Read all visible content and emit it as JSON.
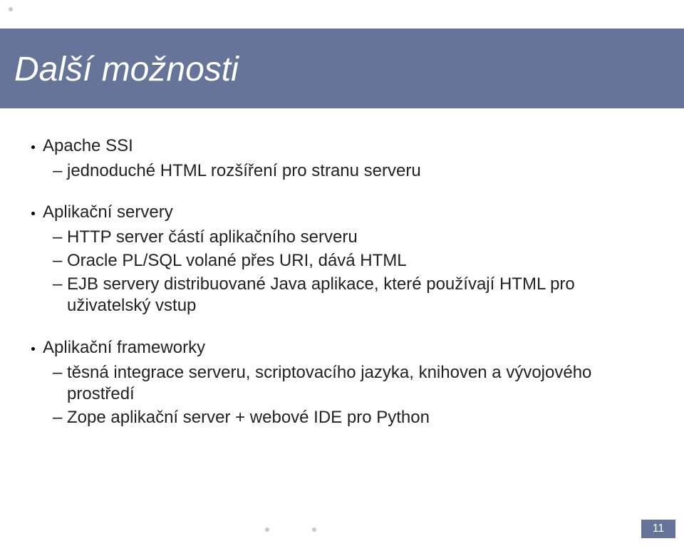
{
  "title": "Další možnosti",
  "sections": [
    {
      "heading": "Apache SSI",
      "items": [
        "jednoduché HTML rozšíření pro stranu serveru"
      ]
    },
    {
      "heading": "Aplikační servery",
      "items": [
        "HTTP server částí aplikačního serveru",
        "Oracle PL/SQL volané přes URI, dává HTML",
        "EJB servery distribuované Java aplikace, které používají HTML pro uživatelský vstup"
      ]
    },
    {
      "heading": "Aplikační frameworky",
      "items": [
        "těsná integrace serveru, scriptovacího jazyka, knihoven a vývojového prostředí",
        "Zope aplikační server + webové IDE pro Python"
      ]
    }
  ],
  "page_number": "11"
}
